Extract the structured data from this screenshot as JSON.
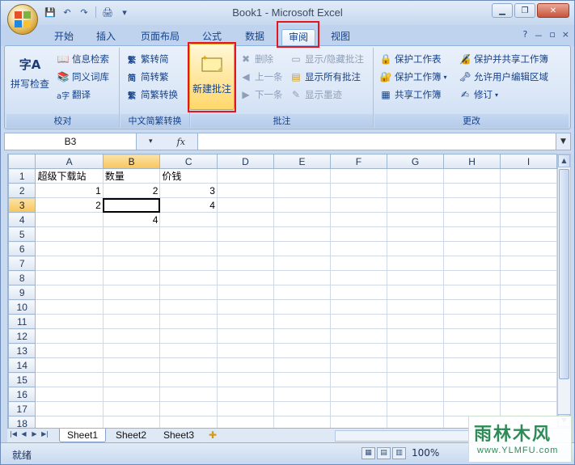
{
  "window": {
    "title": "Book1 - Microsoft Excel",
    "minimize": "▁",
    "restore": "❐",
    "close": "✕"
  },
  "qat": {
    "save": "💾",
    "undo": "↶",
    "redo": "↷",
    "print": "🖨",
    "more": "▾"
  },
  "tabs": [
    {
      "label": "开始"
    },
    {
      "label": "插入"
    },
    {
      "label": "页面布局"
    },
    {
      "label": "公式"
    },
    {
      "label": "数据"
    },
    {
      "label": "审阅",
      "active": true
    },
    {
      "label": "视图"
    }
  ],
  "help": {
    "help": "?",
    "min": "－",
    "restore": "▫",
    "close": "×"
  },
  "ribbon": {
    "proofing": {
      "label": "校对",
      "spell": "拼写检查",
      "spell_icon": "字A",
      "research": "信息检索",
      "thesaurus": "同义词库",
      "translate": "翻译"
    },
    "chinese": {
      "label": "中文简繁转换",
      "to_simplified": "繁转简",
      "to_traditional": "简转繁",
      "convert": "简繁转换"
    },
    "comments": {
      "label": "批注",
      "new": "新建批注",
      "delete": "删除",
      "previous": "上一条",
      "next": "下一条",
      "show_hide": "显示/隐藏批注",
      "show_all": "显示所有批注",
      "show_ink": "显示墨迹"
    },
    "changes": {
      "label": "更改",
      "protect_sheet": "保护工作表",
      "protect_workbook": "保护工作簿",
      "share_workbook": "共享工作簿",
      "protect_share": "保护并共享工作簿",
      "allow_edit": "允许用户编辑区域",
      "track": "修订"
    }
  },
  "formula_bar": {
    "name_box": "B3",
    "fx": "fx",
    "content": ""
  },
  "sheet": {
    "columns": [
      "A",
      "B",
      "C",
      "D",
      "E",
      "F",
      "G",
      "H",
      "I"
    ],
    "selected_column": "B",
    "selected_row": 3,
    "rows": [
      {
        "n": "1",
        "cells": [
          "超级下载站",
          "数量",
          "价钱",
          "",
          "",
          "",
          "",
          "",
          ""
        ]
      },
      {
        "n": "2",
        "cells": [
          "1",
          "2",
          "3",
          "",
          "",
          "",
          "",
          "",
          ""
        ]
      },
      {
        "n": "3",
        "cells": [
          "2",
          "",
          "4",
          "",
          "",
          "",
          "",
          "",
          ""
        ]
      },
      {
        "n": "4",
        "cells": [
          "",
          "4",
          "",
          "",
          "",
          "",
          "",
          "",
          ""
        ]
      },
      {
        "n": "5",
        "cells": [
          "",
          "",
          "",
          "",
          "",
          "",
          "",
          "",
          ""
        ]
      },
      {
        "n": "6",
        "cells": [
          "",
          "",
          "",
          "",
          "",
          "",
          "",
          "",
          ""
        ]
      },
      {
        "n": "7",
        "cells": [
          "",
          "",
          "",
          "",
          "",
          "",
          "",
          "",
          ""
        ]
      },
      {
        "n": "8",
        "cells": [
          "",
          "",
          "",
          "",
          "",
          "",
          "",
          "",
          ""
        ]
      },
      {
        "n": "9",
        "cells": [
          "",
          "",
          "",
          "",
          "",
          "",
          "",
          "",
          ""
        ]
      },
      {
        "n": "10",
        "cells": [
          "",
          "",
          "",
          "",
          "",
          "",
          "",
          "",
          ""
        ]
      },
      {
        "n": "11",
        "cells": [
          "",
          "",
          "",
          "",
          "",
          "",
          "",
          "",
          ""
        ]
      },
      {
        "n": "12",
        "cells": [
          "",
          "",
          "",
          "",
          "",
          "",
          "",
          "",
          ""
        ]
      },
      {
        "n": "13",
        "cells": [
          "",
          "",
          "",
          "",
          "",
          "",
          "",
          "",
          ""
        ]
      },
      {
        "n": "14",
        "cells": [
          "",
          "",
          "",
          "",
          "",
          "",
          "",
          "",
          ""
        ]
      },
      {
        "n": "15",
        "cells": [
          "",
          "",
          "",
          "",
          "",
          "",
          "",
          "",
          ""
        ]
      },
      {
        "n": "16",
        "cells": [
          "",
          "",
          "",
          "",
          "",
          "",
          "",
          "",
          ""
        ]
      },
      {
        "n": "17",
        "cells": [
          "",
          "",
          "",
          "",
          "",
          "",
          "",
          "",
          ""
        ]
      },
      {
        "n": "18",
        "cells": [
          "",
          "",
          "",
          "",
          "",
          "",
          "",
          "",
          ""
        ]
      }
    ]
  },
  "sheet_tabs": [
    "Sheet1",
    "Sheet2",
    "Sheet3"
  ],
  "status": {
    "ready": "就绪",
    "zoom": "100%"
  },
  "watermark": {
    "main": "雨林木风",
    "sub": "www.YLMFU.com"
  },
  "colors": {
    "highlight_box": "#e5151f",
    "ribbon_bg": "#dbe7f7",
    "selected_header": "#f7c55e"
  }
}
